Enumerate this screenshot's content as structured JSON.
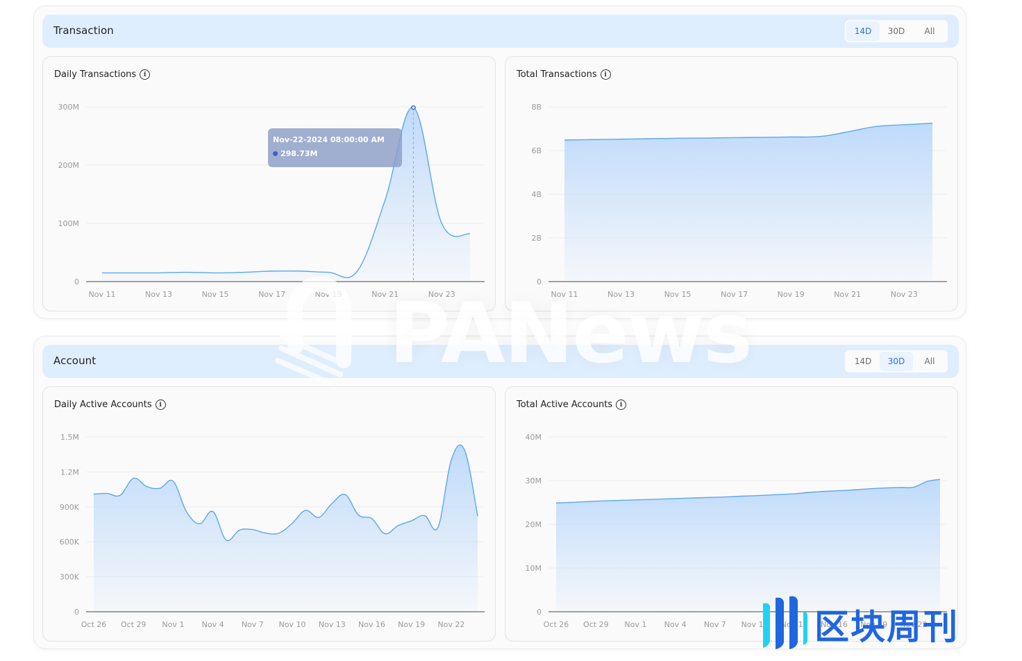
{
  "sections": {
    "transaction": {
      "title": "Transaction",
      "range_options": [
        "14D",
        "30D",
        "All"
      ],
      "active_range": "14D"
    },
    "account": {
      "title": "Account",
      "range_options": [
        "14D",
        "30D",
        "All"
      ],
      "active_range": "30D"
    }
  },
  "tooltip": {
    "date": "Nov-22-2024 08:00:00 AM",
    "value": "298.73M"
  },
  "watermarks": {
    "panews": "PANews",
    "qkzk": "区块周刊"
  },
  "colors": {
    "line": "#5aa6f0",
    "fill_top": "#bcd9fb",
    "accent": "#2a74d6",
    "header_bg": "#dfeeff"
  },
  "chart_data": [
    {
      "id": "daily-transactions",
      "type": "area",
      "title": "Daily Transactions",
      "x": [
        "Nov 11",
        "Nov 12",
        "Nov 13",
        "Nov 14",
        "Nov 15",
        "Nov 16",
        "Nov 17",
        "Nov 18",
        "Nov 19",
        "Nov 20",
        "Nov 21",
        "Nov 22",
        "Nov 23",
        "Nov 24"
      ],
      "values": [
        15,
        15,
        15,
        16,
        15,
        16,
        18,
        18,
        16,
        17,
        140,
        298.73,
        100,
        82
      ],
      "unit": "M",
      "xticks": [
        "Nov 11",
        "Nov 13",
        "Nov 15",
        "Nov 17",
        "Nov 19",
        "Nov 21",
        "Nov 23"
      ],
      "yticks": [
        "0",
        "100M",
        "200M",
        "300M"
      ],
      "ylim": [
        0,
        300
      ],
      "grid": true,
      "highlight_index": 11
    },
    {
      "id": "total-transactions",
      "type": "area",
      "title": "Total Transactions",
      "x": [
        "Nov 11",
        "Nov 12",
        "Nov 13",
        "Nov 14",
        "Nov 15",
        "Nov 16",
        "Nov 17",
        "Nov 18",
        "Nov 19",
        "Nov 20",
        "Nov 21",
        "Nov 22",
        "Nov 23",
        "Nov 24"
      ],
      "values": [
        6.48,
        6.5,
        6.52,
        6.54,
        6.56,
        6.57,
        6.59,
        6.6,
        6.62,
        6.64,
        6.85,
        7.1,
        7.18,
        7.25
      ],
      "unit": "B",
      "xticks": [
        "Nov 11",
        "Nov 13",
        "Nov 15",
        "Nov 17",
        "Nov 19",
        "Nov 21",
        "Nov 23"
      ],
      "yticks": [
        "0",
        "2B",
        "4B",
        "6B",
        "8B"
      ],
      "ylim": [
        0,
        8
      ],
      "grid": true
    },
    {
      "id": "daily-active-accounts",
      "type": "area",
      "title": "Daily Active Accounts",
      "x": [
        "Oct 26",
        "Oct 27",
        "Oct 28",
        "Oct 29",
        "Oct 30",
        "Oct 31",
        "Nov 1",
        "Nov 2",
        "Nov 3",
        "Nov 4",
        "Nov 5",
        "Nov 6",
        "Nov 7",
        "Nov 8",
        "Nov 9",
        "Nov 10",
        "Nov 11",
        "Nov 12",
        "Nov 13",
        "Nov 14",
        "Nov 15",
        "Nov 16",
        "Nov 17",
        "Nov 18",
        "Nov 19",
        "Nov 20",
        "Nov 21",
        "Nov 22",
        "Nov 23",
        "Nov 24"
      ],
      "values": [
        1010,
        1015,
        1000,
        1145,
        1075,
        1060,
        1120,
        860,
        755,
        860,
        615,
        700,
        705,
        675,
        675,
        760,
        870,
        810,
        930,
        1005,
        830,
        800,
        670,
        740,
        780,
        825,
        725,
        1300,
        1390,
        820
      ],
      "unit": "K",
      "xticks": [
        "Oct 26",
        "Oct 29",
        "Nov 1",
        "Nov 4",
        "Nov 7",
        "Nov 10",
        "Nov 13",
        "Nov 16",
        "Nov 19",
        "Nov 22"
      ],
      "yticks": [
        "0",
        "300K",
        "600K",
        "900K",
        "1.2M",
        "1.5M"
      ],
      "ylim": [
        0,
        1500
      ],
      "grid": true
    },
    {
      "id": "total-active-accounts",
      "type": "area",
      "title": "Total Active Accounts",
      "x": [
        "Oct 26",
        "Oct 27",
        "Oct 28",
        "Oct 29",
        "Oct 30",
        "Oct 31",
        "Nov 1",
        "Nov 2",
        "Nov 3",
        "Nov 4",
        "Nov 5",
        "Nov 6",
        "Nov 7",
        "Nov 8",
        "Nov 9",
        "Nov 10",
        "Nov 11",
        "Nov 12",
        "Nov 13",
        "Nov 14",
        "Nov 15",
        "Nov 16",
        "Nov 17",
        "Nov 18",
        "Nov 19",
        "Nov 20",
        "Nov 21",
        "Nov 22",
        "Nov 23",
        "Nov 24"
      ],
      "values": [
        24.9,
        25.0,
        25.15,
        25.3,
        25.4,
        25.5,
        25.6,
        25.7,
        25.8,
        25.9,
        26.0,
        26.1,
        26.2,
        26.3,
        26.45,
        26.55,
        26.7,
        26.85,
        27.0,
        27.3,
        27.5,
        27.65,
        27.8,
        28.0,
        28.2,
        28.35,
        28.45,
        28.5,
        29.8,
        30.3
      ],
      "unit": "M",
      "xticks": [
        "Oct 26",
        "Oct 29",
        "Nov 1",
        "Nov 4",
        "Nov 7",
        "Nov 10",
        "Nov 13",
        "Nov 16",
        "Nov 19",
        "Nov 22"
      ],
      "yticks": [
        "0",
        "10M",
        "20M",
        "30M",
        "40M"
      ],
      "ylim": [
        0,
        40
      ],
      "grid": true
    }
  ]
}
